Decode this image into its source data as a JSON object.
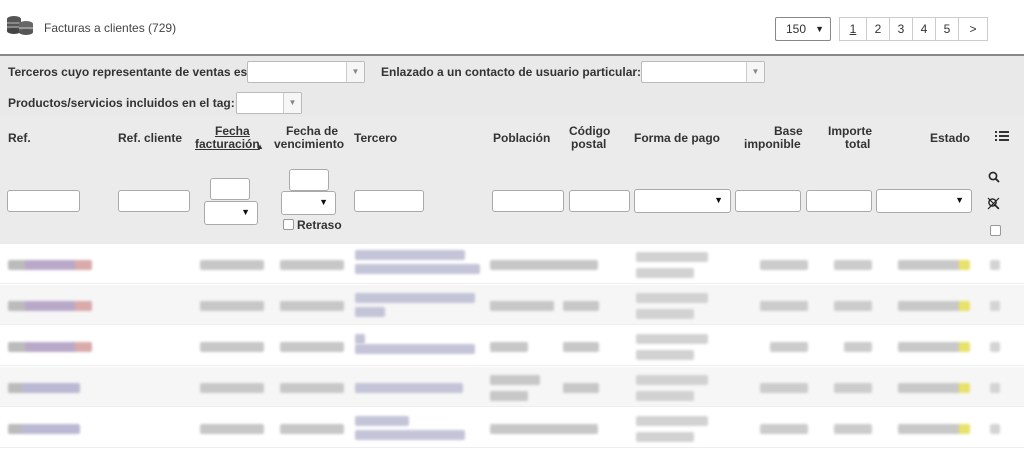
{
  "header": {
    "title": "Facturas a clientes (729)",
    "limit": "150",
    "pages": [
      "1",
      "2",
      "3",
      "4",
      "5"
    ],
    "next": ">"
  },
  "filters": {
    "sales_rep_label": "Terceros cuyo representante de ventas es:",
    "contact_label": "Enlazado a un contacto de usuario particular:",
    "tag_label": "Productos/servicios incluidos en el tag:"
  },
  "columns": {
    "ref": "Ref.",
    "ref_client": "Ref. cliente",
    "date_invoice_1": "Fecha",
    "date_invoice_2": "facturación",
    "sort_mark": "▲",
    "due_date_1": "Fecha de",
    "due_date_2": "vencimiento",
    "thirdparty": "Tercero",
    "town": "Población",
    "zip_1": "Código",
    "zip_2": "postal",
    "payment": "Forma de pago",
    "base_1": "Base",
    "base_2": "imponible",
    "total_1": "Importe",
    "total_2": "total",
    "status": "Estado"
  },
  "search": {
    "late_label": "Retraso"
  },
  "colors": {
    "header_bg": "#ebebeb",
    "border": "#888888",
    "status_accent": "#e8e26a"
  }
}
